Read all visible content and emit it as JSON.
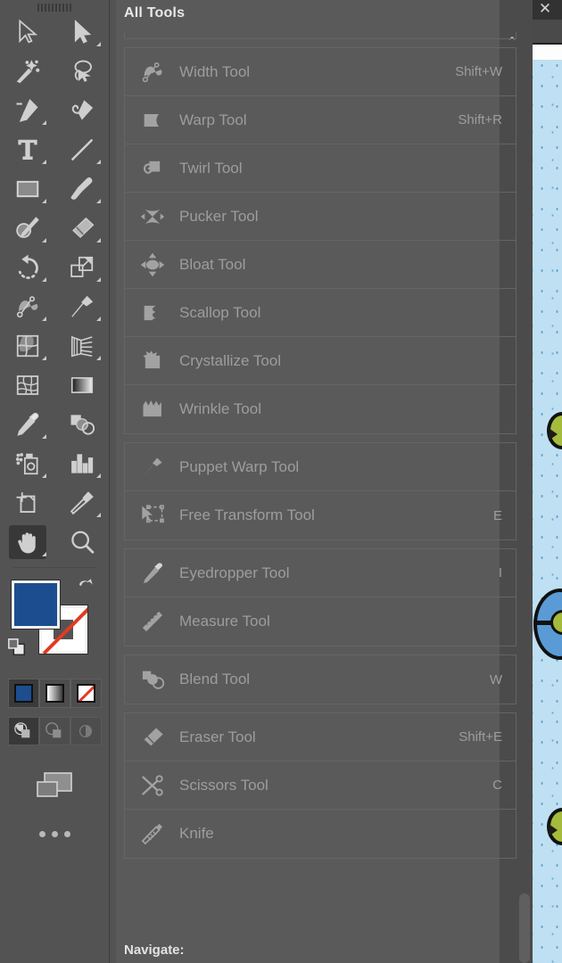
{
  "app": {
    "close_label": "✕",
    "accent_fill": "#1c4e8f",
    "panel_bg": "#5a5a5a",
    "toolbar_bg": "#535353",
    "text_color": "#9d9d9d"
  },
  "panel": {
    "title": "All Tools",
    "footer_label": "Navigate:",
    "scroll_up_glyph": "⌃",
    "groups": [
      {
        "clipped": true,
        "items": []
      },
      {
        "clipped": false,
        "items": [
          {
            "icon": "width-tool-icon",
            "label": "Width Tool",
            "shortcut": "Shift+W"
          },
          {
            "icon": "warp-tool-icon",
            "label": "Warp Tool",
            "shortcut": "Shift+R"
          },
          {
            "icon": "twirl-tool-icon",
            "label": "Twirl Tool",
            "shortcut": ""
          },
          {
            "icon": "pucker-tool-icon",
            "label": "Pucker Tool",
            "shortcut": ""
          },
          {
            "icon": "bloat-tool-icon",
            "label": "Bloat Tool",
            "shortcut": ""
          },
          {
            "icon": "scallop-tool-icon",
            "label": "Scallop Tool",
            "shortcut": ""
          },
          {
            "icon": "crystallize-tool-icon",
            "label": "Crystallize Tool",
            "shortcut": ""
          },
          {
            "icon": "wrinkle-tool-icon",
            "label": "Wrinkle Tool",
            "shortcut": ""
          }
        ]
      },
      {
        "clipped": false,
        "items": [
          {
            "icon": "puppet-warp-tool-icon",
            "label": "Puppet Warp Tool",
            "shortcut": ""
          },
          {
            "icon": "free-transform-tool-icon",
            "label": "Free Transform Tool",
            "shortcut": "E"
          }
        ]
      },
      {
        "clipped": false,
        "items": [
          {
            "icon": "eyedropper-tool-icon",
            "label": "Eyedropper Tool",
            "shortcut": "I"
          },
          {
            "icon": "measure-tool-icon",
            "label": "Measure Tool",
            "shortcut": ""
          }
        ]
      },
      {
        "clipped": false,
        "items": [
          {
            "icon": "blend-tool-icon",
            "label": "Blend Tool",
            "shortcut": "W"
          }
        ]
      },
      {
        "clipped": false,
        "items": [
          {
            "icon": "eraser-tool-icon",
            "label": "Eraser Tool",
            "shortcut": "Shift+E"
          },
          {
            "icon": "scissors-tool-icon",
            "label": "Scissors Tool",
            "shortcut": "C"
          },
          {
            "icon": "knife-tool-icon",
            "label": "Knife",
            "shortcut": ""
          }
        ]
      }
    ]
  },
  "toolbar": {
    "rows": [
      [
        {
          "icon": "selection-tool-icon",
          "flyout": false,
          "active": false
        },
        {
          "icon": "direct-selection-tool-icon",
          "flyout": true,
          "active": false
        }
      ],
      [
        {
          "icon": "magic-wand-tool-icon",
          "flyout": false,
          "active": false
        },
        {
          "icon": "lasso-tool-icon",
          "flyout": false,
          "active": false
        }
      ],
      [
        {
          "icon": "pen-tool-icon",
          "flyout": true,
          "active": false
        },
        {
          "icon": "curvature-tool-icon",
          "flyout": false,
          "active": false
        }
      ],
      [
        {
          "icon": "type-tool-icon",
          "flyout": true,
          "active": false
        },
        {
          "icon": "line-segment-tool-icon",
          "flyout": true,
          "active": false
        }
      ],
      [
        {
          "icon": "rectangle-tool-icon",
          "flyout": true,
          "active": false
        },
        {
          "icon": "paintbrush-tool-icon",
          "flyout": true,
          "active": false
        }
      ],
      [
        {
          "icon": "shaper-tool-icon",
          "flyout": true,
          "active": false
        },
        {
          "icon": "eraser-tool-icon",
          "flyout": true,
          "active": false
        }
      ],
      [
        {
          "icon": "rotate-tool-icon",
          "flyout": true,
          "active": false
        },
        {
          "icon": "scale-tool-icon",
          "flyout": true,
          "active": false
        }
      ],
      [
        {
          "icon": "width-tool-icon",
          "flyout": true,
          "active": false
        },
        {
          "icon": "puppet-warp-tool-icon",
          "flyout": true,
          "active": false
        }
      ],
      [
        {
          "icon": "shape-builder-tool-icon",
          "flyout": true,
          "active": false
        },
        {
          "icon": "perspective-grid-tool-icon",
          "flyout": true,
          "active": false
        }
      ],
      [
        {
          "icon": "mesh-tool-icon",
          "flyout": false,
          "active": false
        },
        {
          "icon": "gradient-tool-icon",
          "flyout": false,
          "active": false
        }
      ],
      [
        {
          "icon": "eyedropper-tool-icon",
          "flyout": true,
          "active": false
        },
        {
          "icon": "blend-tool-icon",
          "flyout": false,
          "active": false
        }
      ],
      [
        {
          "icon": "symbol-sprayer-tool-icon",
          "flyout": true,
          "active": false
        },
        {
          "icon": "column-graph-tool-icon",
          "flyout": true,
          "active": false
        }
      ],
      [
        {
          "icon": "artboard-tool-icon",
          "flyout": false,
          "active": false
        },
        {
          "icon": "slice-tool-icon",
          "flyout": true,
          "active": false
        }
      ],
      [
        {
          "icon": "hand-tool-icon",
          "flyout": true,
          "active": true
        },
        {
          "icon": "zoom-tool-icon",
          "flyout": false,
          "active": false
        }
      ]
    ],
    "color_controls": {
      "fill_color": "#1c4e8f",
      "stroke_color": "#ffffff",
      "stroke_is_none": true,
      "swap_icon": "swap-fill-stroke-icon",
      "default_icon": "default-fill-stroke-icon"
    },
    "fill_modes": [
      {
        "icon": "color-fill-icon",
        "active": true
      },
      {
        "icon": "gradient-fill-icon",
        "active": false
      },
      {
        "icon": "none-fill-icon",
        "active": false
      }
    ],
    "draw_modes": [
      {
        "icon": "draw-normal-icon",
        "active": true
      },
      {
        "icon": "draw-behind-icon",
        "active": false
      },
      {
        "icon": "draw-inside-icon",
        "active": false
      }
    ],
    "screen_mode_icon": "change-screen-mode-icon",
    "more_icon": "edit-toolbar-ellipsis-icon"
  },
  "canvas": {
    "background_color": "#bfe0f2",
    "dot_color": "#4b9ad4",
    "shapes": [
      {
        "name": "olive-circle-top",
        "fill": "#a4bb3b",
        "stroke": "#111111"
      },
      {
        "name": "blue-lens-shape",
        "fill": "#5b9bd5",
        "stroke": "#111111"
      },
      {
        "name": "olive-circle-bottom",
        "fill": "#a4bb3b",
        "stroke": "#111111"
      }
    ]
  }
}
